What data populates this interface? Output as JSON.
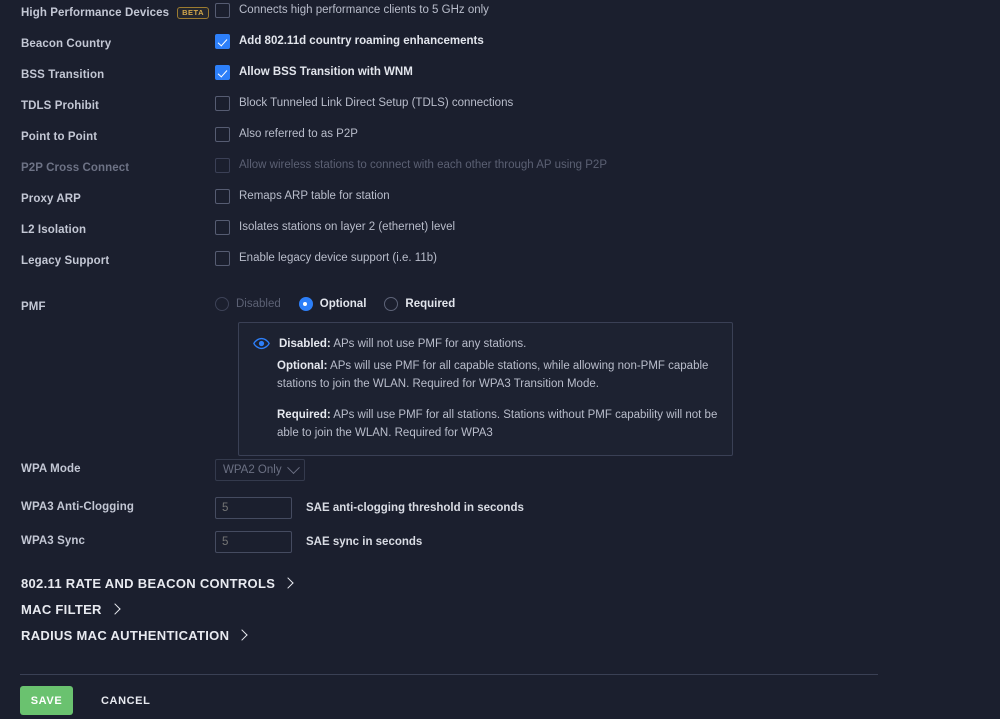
{
  "colors": {
    "background": "#1b1f2e",
    "accent_blue": "#2d7ff9",
    "save_green": "#6ac26f",
    "beta_gold": "#d3a84c",
    "label": "#c3c7d4",
    "panel_border": "#3a4055"
  },
  "settings_rows": [
    {
      "label": "High Performance Devices",
      "badge": "BETA",
      "control": "checkbox",
      "checked": false,
      "disabled": false,
      "bold_text": false,
      "text": "Connects high performance clients to 5 GHz only"
    },
    {
      "label": "Beacon Country",
      "badge": "",
      "control": "checkbox",
      "checked": true,
      "disabled": false,
      "bold_text": true,
      "text": "Add 802.11d country roaming enhancements"
    },
    {
      "label": "BSS Transition",
      "badge": "",
      "control": "checkbox",
      "checked": true,
      "disabled": false,
      "bold_text": true,
      "text": "Allow BSS Transition with WNM"
    },
    {
      "label": "TDLS Prohibit",
      "badge": "",
      "control": "checkbox",
      "checked": false,
      "disabled": false,
      "bold_text": false,
      "text": "Block Tunneled Link Direct Setup (TDLS) connections"
    },
    {
      "label": "Point to Point",
      "badge": "",
      "control": "checkbox",
      "checked": false,
      "disabled": false,
      "bold_text": false,
      "text": "Also referred to as P2P"
    },
    {
      "label": "P2P Cross Connect",
      "badge": "",
      "control": "checkbox",
      "checked": false,
      "disabled": true,
      "bold_text": false,
      "text": "Allow wireless stations to connect with each other through AP using P2P"
    },
    {
      "label": "Proxy ARP",
      "badge": "",
      "control": "checkbox",
      "checked": false,
      "disabled": false,
      "bold_text": false,
      "text": "Remaps ARP table for station"
    },
    {
      "label": "L2 Isolation",
      "badge": "",
      "control": "checkbox",
      "checked": false,
      "disabled": false,
      "bold_text": false,
      "text": "Isolates stations on layer 2 (ethernet) level"
    },
    {
      "label": "Legacy Support",
      "badge": "",
      "control": "checkbox",
      "checked": false,
      "disabled": false,
      "bold_text": false,
      "text": "Enable legacy device support (i.e. 11b)"
    }
  ],
  "pmf": {
    "label": "PMF",
    "options": [
      {
        "label": "Disabled",
        "selected": false,
        "disabled": true
      },
      {
        "label": "Optional",
        "selected": true,
        "disabled": false
      },
      {
        "label": "Required",
        "selected": false,
        "disabled": false
      }
    ]
  },
  "pmf_info": {
    "icon": "eye-icon",
    "paragraphs": [
      {
        "term": "Disabled:",
        "body": " APs will not use PMF for any stations."
      },
      {
        "term": "Optional:",
        "body": " APs will use PMF for all capable stations, while allowing non-PMF capable stations to join the WLAN. Required for WPA3 Transition Mode."
      },
      {
        "term": "Required:",
        "body": " APs will use PMF for all stations. Stations without PMF capability will not be able to join the WLAN. Required for WPA3"
      }
    ]
  },
  "wpa_mode": {
    "label": "WPA Mode",
    "selected": "WPA2 Only",
    "disabled": true
  },
  "wpa3_anti_clogging": {
    "label": "WPA3 Anti-Clogging",
    "value": "5",
    "placeholder": "5",
    "hint": "SAE anti-clogging threshold in seconds"
  },
  "wpa3_sync": {
    "label": "WPA3 Sync",
    "value": "5",
    "placeholder": "5",
    "hint": "SAE sync in seconds"
  },
  "section_links": [
    {
      "label": "802.11 RATE AND BEACON CONTROLS"
    },
    {
      "label": "MAC FILTER"
    },
    {
      "label": "RADIUS MAC AUTHENTICATION"
    }
  ],
  "footer": {
    "save_label": "SAVE",
    "cancel_label": "CANCEL"
  }
}
